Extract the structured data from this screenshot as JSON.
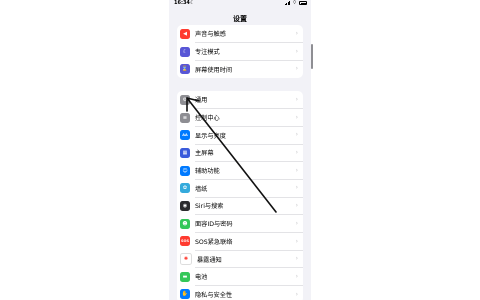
{
  "status": {
    "time": "16:34"
  },
  "title": "设置",
  "group_top": [
    {
      "label": "声音与触感",
      "icon": "speaker-icon",
      "color": "#ff3b30",
      "glyph": "◀"
    },
    {
      "label": "专注模式",
      "icon": "moon-icon",
      "color": "#5856d6",
      "glyph": "☾"
    },
    {
      "label": "屏幕使用时间",
      "icon": "hourglass-icon",
      "color": "#5856d6",
      "glyph": "⌛"
    }
  ],
  "group_main": [
    {
      "label": "通用",
      "icon": "gear-icon",
      "color": "#8e8e93",
      "glyph": "⚙"
    },
    {
      "label": "控制中心",
      "icon": "switches-icon",
      "color": "#8e8e93",
      "glyph": "≡"
    },
    {
      "label": "显示与亮度",
      "icon": "aa-icon",
      "color": "#007aff",
      "glyph": "AA"
    },
    {
      "label": "主屏幕",
      "icon": "home-grid-icon",
      "color": "#3b5bdb",
      "glyph": "▦"
    },
    {
      "label": "辅助功能",
      "icon": "accessibility-icon",
      "color": "#007aff",
      "glyph": "☺"
    },
    {
      "label": "墙纸",
      "icon": "wallpaper-icon",
      "color": "#34aadc",
      "glyph": "✿"
    },
    {
      "label": "Siri与搜索",
      "icon": "siri-icon",
      "color": "#2c2c2e",
      "glyph": "◉"
    },
    {
      "label": "面容ID与密码",
      "icon": "faceid-icon",
      "color": "#34c759",
      "glyph": "☻"
    },
    {
      "label": "SOS紧急联络",
      "icon": "sos-icon",
      "color": "#ff3b30",
      "glyph": "SOS"
    },
    {
      "label": "暴露通知",
      "icon": "exposure-icon",
      "color": "#ffffff",
      "glyph": "✺"
    },
    {
      "label": "电池",
      "icon": "battery-icon",
      "color": "#34c759",
      "glyph": "▬"
    },
    {
      "label": "隐私与安全性",
      "icon": "hand-icon",
      "color": "#007aff",
      "glyph": "✋"
    }
  ],
  "chevron": "›"
}
